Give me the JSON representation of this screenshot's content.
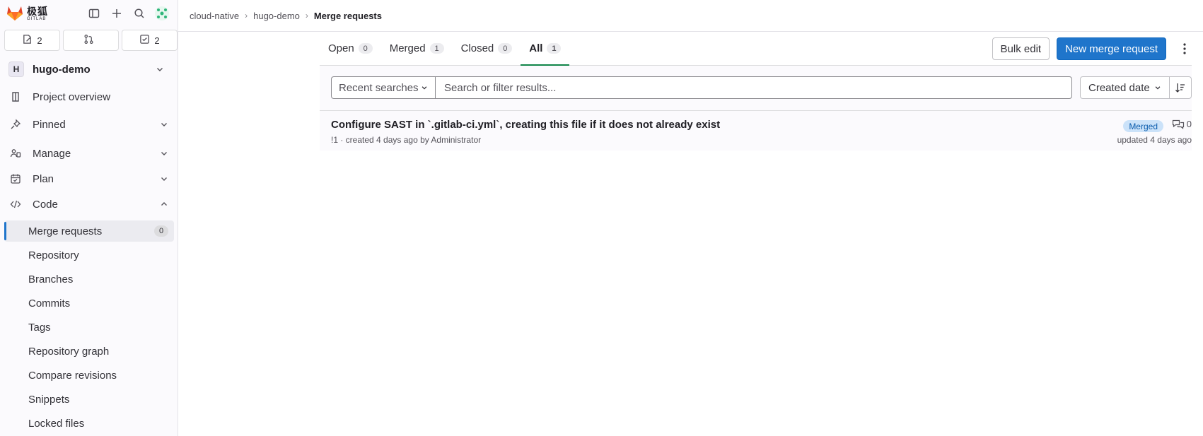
{
  "brand": {
    "name_cn": "极狐",
    "name_en": "GITLAB"
  },
  "colors": {
    "primary": "#1f75cb",
    "active_tab": "#108548",
    "merged_badge_bg": "#cbe2f9",
    "merged_badge_text": "#0b5cad",
    "logo_orange": "#e24329"
  },
  "sidebar": {
    "counts": {
      "issues": "2",
      "merge_requests": "",
      "todos": "2"
    },
    "project": {
      "initial": "H",
      "name": "hugo-demo"
    },
    "nav": {
      "overview": "Project overview",
      "pinned": "Pinned",
      "manage": "Manage",
      "plan": "Plan",
      "code": "Code"
    },
    "code_items": [
      {
        "label": "Merge requests",
        "badge": "0"
      },
      {
        "label": "Repository"
      },
      {
        "label": "Branches"
      },
      {
        "label": "Commits"
      },
      {
        "label": "Tags"
      },
      {
        "label": "Repository graph"
      },
      {
        "label": "Compare revisions"
      },
      {
        "label": "Snippets"
      },
      {
        "label": "Locked files"
      }
    ]
  },
  "breadcrumb": [
    "cloud-native",
    "hugo-demo",
    "Merge requests"
  ],
  "tabs": [
    {
      "label": "Open",
      "count": "0"
    },
    {
      "label": "Merged",
      "count": "1"
    },
    {
      "label": "Closed",
      "count": "0"
    },
    {
      "label": "All",
      "count": "1"
    }
  ],
  "actions": {
    "bulk_edit": "Bulk edit",
    "new_mr": "New merge request"
  },
  "filter": {
    "recent_searches": "Recent searches",
    "search_placeholder": "Search or filter results...",
    "sort_label": "Created date"
  },
  "merge_requests": [
    {
      "title": "Configure SAST in `.gitlab-ci.yml`, creating this file if it does not already exist",
      "meta": "!1 · created 4 days ago by Administrator",
      "status": "Merged",
      "comments": "0",
      "updated": "updated 4 days ago"
    }
  ]
}
